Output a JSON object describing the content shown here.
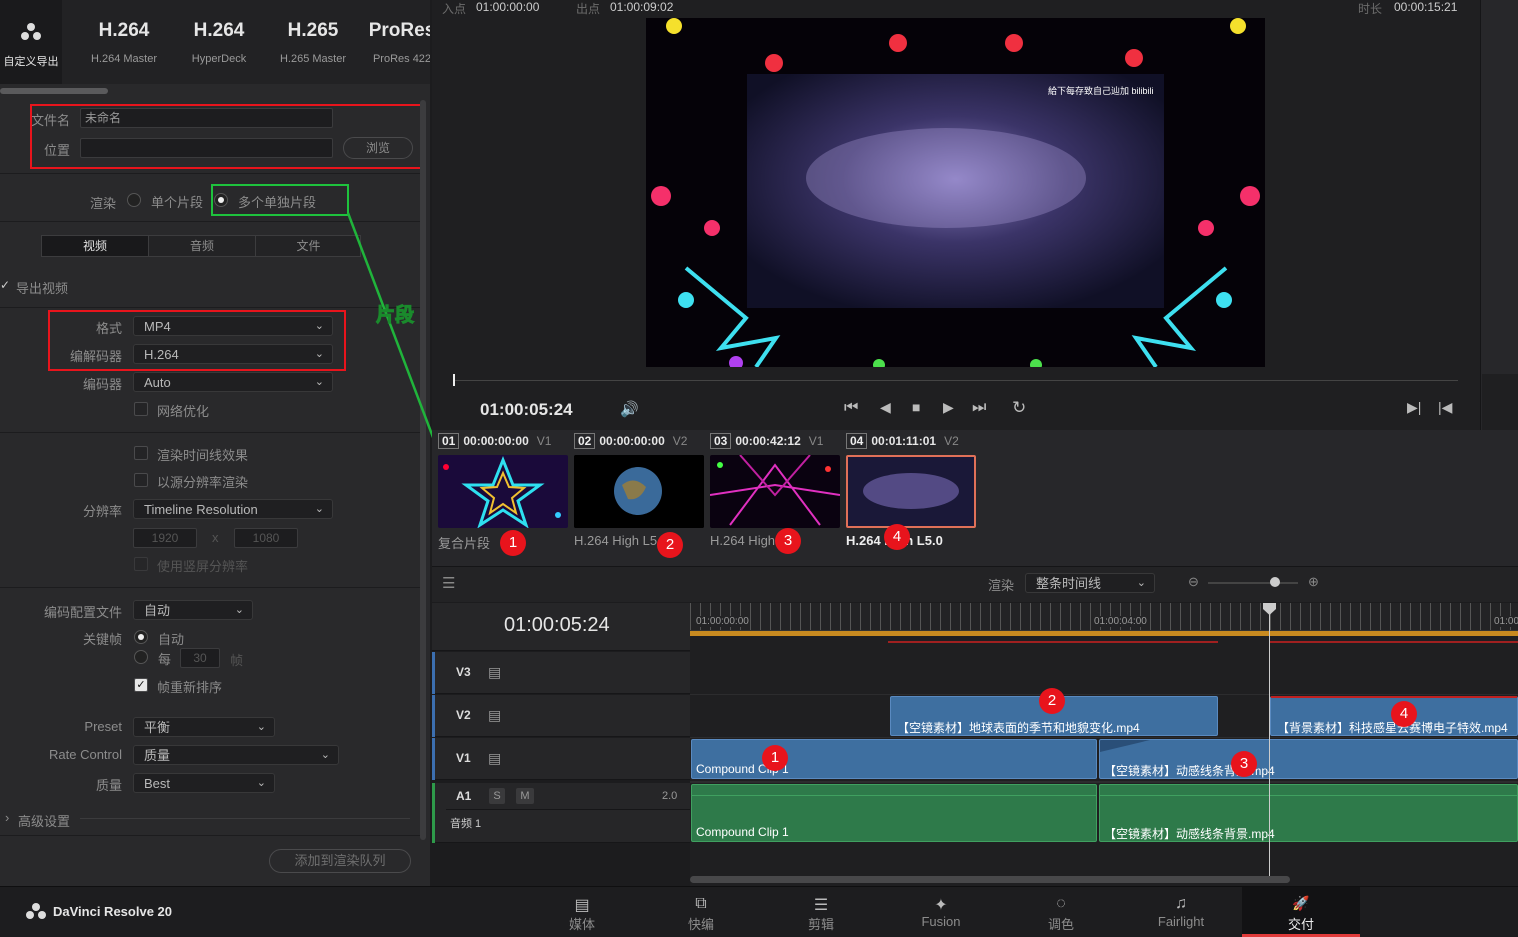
{
  "presets": [
    {
      "big": "",
      "small": "自定义导出",
      "active": true
    },
    {
      "big": "H.264",
      "small": "H.264 Master"
    },
    {
      "big": "H.264",
      "small": "HyperDeck"
    },
    {
      "big": "H.265",
      "small": "H.265 Master"
    },
    {
      "big": "ProRes",
      "small": "ProRes 422"
    }
  ],
  "file": {
    "name_label": "文件名",
    "name_value": "未命名",
    "location_label": "位置",
    "browse": "浏览"
  },
  "render": {
    "label": "渲染",
    "single": "单个片段",
    "multi": "多个单独片段"
  },
  "tabs": [
    "视频",
    "音频",
    "文件"
  ],
  "export_video": "导出视频",
  "format": {
    "label": "格式",
    "value": "MP4"
  },
  "codec": {
    "label": "编解码器",
    "value": "H.264"
  },
  "encoder": {
    "label": "编码器",
    "value": "Auto"
  },
  "network_opt": "网络优化",
  "render_timeline_effects": "渲染时间线效果",
  "render_source_res": "以源分辨率渲染",
  "resolution": {
    "label": "分辨率",
    "value": "Timeline Resolution",
    "w": "1920",
    "x": "x",
    "h": "1080"
  },
  "vertical_res": "使用竖屏分辨率",
  "encode_profile": {
    "label": "编码配置文件",
    "value": "自动"
  },
  "keyframe": {
    "label": "关键帧",
    "auto": "自动",
    "every": "每",
    "every_value": "30",
    "unit": "帧"
  },
  "frame_reorder": "帧重新排序",
  "preset_field": {
    "label": "Preset",
    "value": "平衡"
  },
  "rate_control": {
    "label": "Rate Control",
    "value": "质量"
  },
  "quality": {
    "label": "质量",
    "value": "Best"
  },
  "advanced": "高级设置",
  "add_queue": "添加到渲染队列",
  "annotation_label": "片段",
  "viewer": {
    "in_label": "入点",
    "in_tc": "01:00:00:00",
    "out_label": "出点",
    "out_tc": "01:00:09:02",
    "dur_label": "时长",
    "dur_tc": "00:00:15:21",
    "timecode": "01:00:05:24",
    "watermark": "給下每存致自己辿加 bilibili"
  },
  "clips": [
    {
      "num": "01",
      "tc": "00:00:00:00",
      "track": "V1",
      "name": "复合片段",
      "badge": "1"
    },
    {
      "num": "02",
      "tc": "00:00:00:00",
      "track": "V2",
      "name": "H.264 High L5",
      "badge": "2"
    },
    {
      "num": "03",
      "tc": "00:00:42:12",
      "track": "V1",
      "name": "H.264 High",
      "badge": "3"
    },
    {
      "num": "04",
      "tc": "00:01:11:01",
      "track": "V2",
      "name": "H.264 High L5.0",
      "badge": "4"
    }
  ],
  "timeline_bar": {
    "render_label": "渲染",
    "render_value": "整条时间线"
  },
  "timeline": {
    "timecode": "01:00:05:24",
    "ruler": [
      "01:00:00:00",
      "01:00:04:00",
      "01:00"
    ]
  },
  "tracks": {
    "v3": "V3",
    "v2": "V2",
    "v1": "V1",
    "a1": "A1",
    "a1_s": "S",
    "a1_m": "M",
    "a1_level": "2.0",
    "a1_name": "音频 1"
  },
  "tl_clips": {
    "v2a": "【空镜素材】地球表面的季节和地貌变化.mp4",
    "v2b": "【背景素材】科技感星云赛博电子特效.mp4",
    "v1a": "Compound Clip 1",
    "v1b": "【空镜素材】动感线条背景.mp4",
    "a1a": "Compound Clip 1",
    "a1b": "【空镜素材】动感线条背景.mp4"
  },
  "app_name": "DaVinci Resolve 20",
  "nav": [
    {
      "label": "媒体",
      "icon": "▤"
    },
    {
      "label": "快编",
      "icon": "⧉"
    },
    {
      "label": "剪辑",
      "icon": "☰"
    },
    {
      "label": "Fusion",
      "icon": "✦"
    },
    {
      "label": "调色",
      "icon": "◌"
    },
    {
      "label": "Fairlight",
      "icon": "♫"
    },
    {
      "label": "交付",
      "icon": "🚀"
    }
  ]
}
